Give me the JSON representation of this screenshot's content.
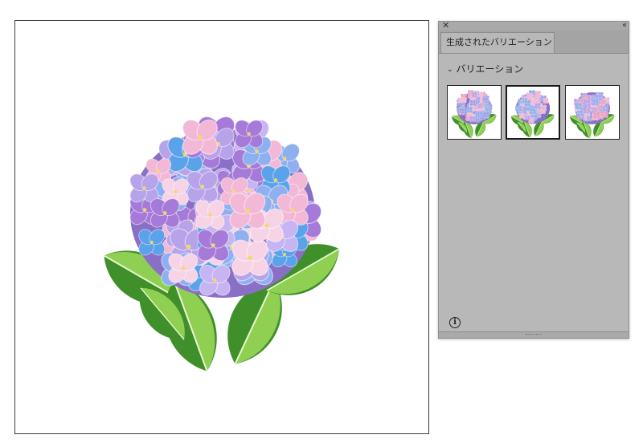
{
  "panel": {
    "tab_label": "生成されたバリエーション",
    "section_label": "バリエーション",
    "close_glyph": "✕",
    "collapse_glyph": "‹‹",
    "info_glyph": "i",
    "chevron_glyph": "⌄"
  },
  "artboard": {
    "content": "hydrangea illustration"
  },
  "variations": [
    {
      "name": "variation-1",
      "flower_primary": "#9aa2e8",
      "flower_secondary": "#e8a4cf"
    },
    {
      "name": "variation-2",
      "flower_primary": "#8fb0ea",
      "flower_secondary": "#f0b4d4"
    },
    {
      "name": "variation-3",
      "flower_primary": "#a0a8ee",
      "flower_secondary": "#e6a0c8"
    }
  ],
  "colors": {
    "panel_bg": "#b8b8b8",
    "leaf_dark": "#3f8f2a",
    "leaf_light": "#8fcf52",
    "petal_blue": "#8fb0f0",
    "petal_lilac": "#b7a3ea",
    "petal_pink": "#f2b8d6",
    "petal_purple": "#a57ad8",
    "petal_sky": "#5aa2ea"
  }
}
